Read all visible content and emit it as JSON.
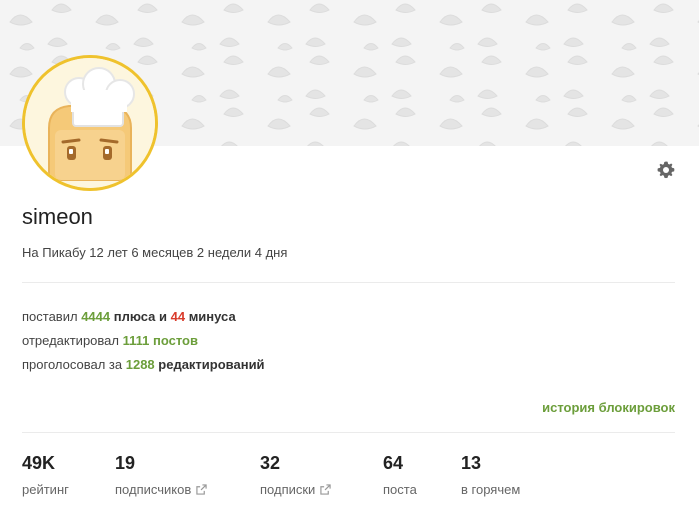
{
  "profile": {
    "username": "simeon",
    "tenure": "На Пикабу 12 лет 6 месяцев 2 недели 4 дня"
  },
  "activity": {
    "line1": {
      "prefix": "поставил ",
      "plus_count": "4444",
      "mid": " плюса и ",
      "minus_count": "44",
      "suffix": " минуса"
    },
    "line2": {
      "prefix": "отредактировал ",
      "count": "1111",
      "suffix": " постов"
    },
    "line3": {
      "prefix": "проголосовал за ",
      "count": "1288",
      "suffix": " редактирований"
    }
  },
  "links": {
    "ban_history": "история блокировок"
  },
  "stats": [
    {
      "value": "49K",
      "label": "рейтинг"
    },
    {
      "value": "19",
      "label": "подписчиков"
    },
    {
      "value": "32",
      "label": "подписки"
    },
    {
      "value": "64",
      "label": "поста"
    },
    {
      "value": "13",
      "label": "в горячем"
    }
  ],
  "icons": {
    "settings": "gear-icon",
    "external": "external-link-icon"
  },
  "colors": {
    "accent_green": "#6c9e3b",
    "minus_red": "#d93b2b",
    "avatar_border": "#efc22d"
  }
}
